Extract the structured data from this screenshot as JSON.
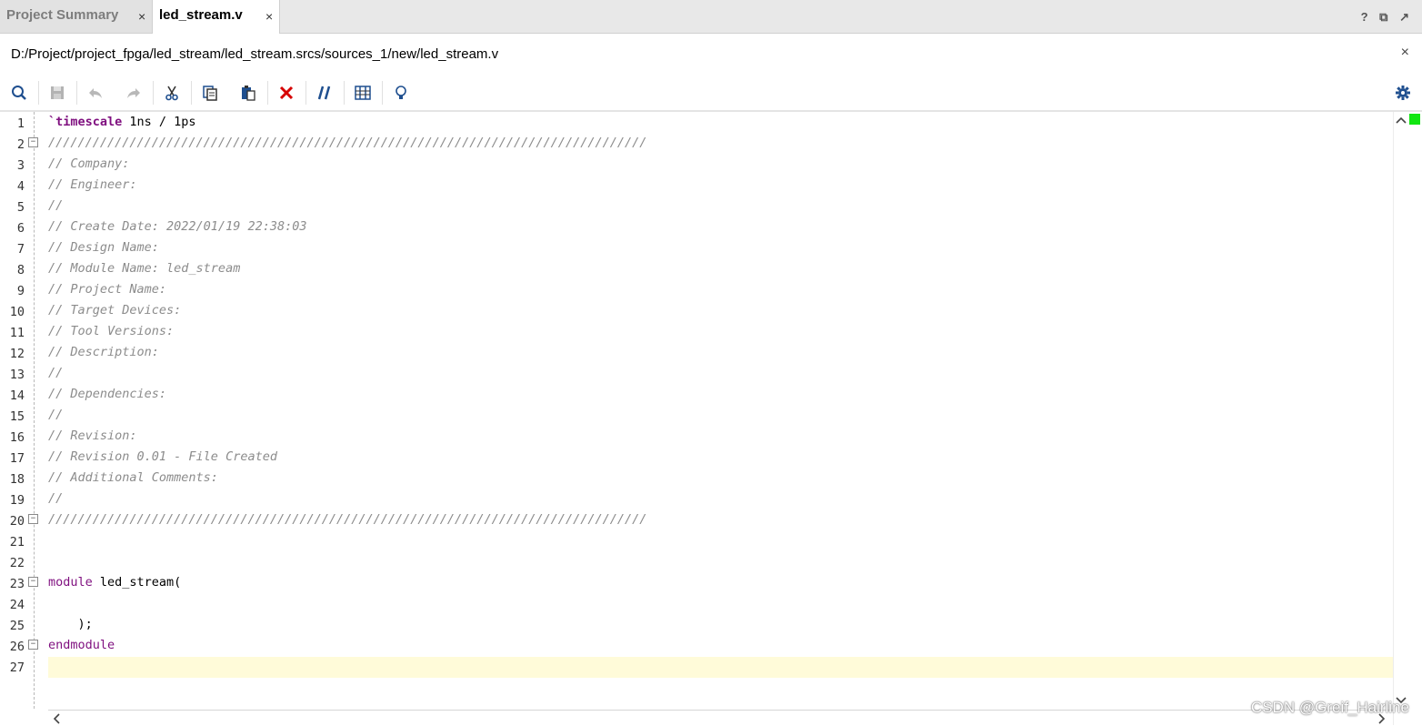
{
  "tabs": [
    {
      "label": "Project Summary",
      "close": "×"
    },
    {
      "label": "led_stream.v",
      "close": "×"
    }
  ],
  "window_icons": {
    "help": "?",
    "restore": "⧉",
    "float": "↗"
  },
  "path": {
    "text": "D:/Project/project_fpga/led_stream/led_stream.srcs/sources_1/new/led_stream.v",
    "close": "×"
  },
  "toolbar": {
    "icons": [
      "search-icon",
      "save-icon",
      "undo-icon",
      "redo-icon",
      "cut-icon",
      "copy-icon",
      "paste-icon",
      "delete-icon",
      "comment-icon",
      "columns-icon",
      "lightbulb-icon",
      "settings-icon"
    ]
  },
  "editor": {
    "highlight_line": 27,
    "lines": [
      {
        "n": "1",
        "parts": [
          {
            "t": "`timescale",
            "c": "kwb"
          },
          {
            "t": " 1ns / 1ps",
            "c": "plain"
          }
        ]
      },
      {
        "n": "2",
        "fold": true,
        "parts": [
          {
            "t": "/////////////////////////////////////////////////////////////////////////////////",
            "c": "comment"
          }
        ]
      },
      {
        "n": "3",
        "parts": [
          {
            "t": "// Company:",
            "c": "comment"
          }
        ]
      },
      {
        "n": "4",
        "parts": [
          {
            "t": "// Engineer:",
            "c": "comment"
          }
        ]
      },
      {
        "n": "5",
        "parts": [
          {
            "t": "//",
            "c": "comment"
          }
        ]
      },
      {
        "n": "6",
        "parts": [
          {
            "t": "// Create Date: 2022/01/19 22:38:03",
            "c": "comment"
          }
        ]
      },
      {
        "n": "7",
        "parts": [
          {
            "t": "// Design Name:",
            "c": "comment"
          }
        ]
      },
      {
        "n": "8",
        "parts": [
          {
            "t": "// Module Name: led_stream",
            "c": "comment"
          }
        ]
      },
      {
        "n": "9",
        "parts": [
          {
            "t": "// Project Name:",
            "c": "comment"
          }
        ]
      },
      {
        "n": "10",
        "parts": [
          {
            "t": "// Target Devices:",
            "c": "comment"
          }
        ]
      },
      {
        "n": "11",
        "parts": [
          {
            "t": "// Tool Versions:",
            "c": "comment"
          }
        ]
      },
      {
        "n": "12",
        "parts": [
          {
            "t": "// Description:",
            "c": "comment"
          }
        ]
      },
      {
        "n": "13",
        "parts": [
          {
            "t": "//",
            "c": "comment"
          }
        ]
      },
      {
        "n": "14",
        "parts": [
          {
            "t": "// Dependencies:",
            "c": "comment"
          }
        ]
      },
      {
        "n": "15",
        "parts": [
          {
            "t": "//",
            "c": "comment"
          }
        ]
      },
      {
        "n": "16",
        "parts": [
          {
            "t": "// Revision:",
            "c": "comment"
          }
        ]
      },
      {
        "n": "17",
        "parts": [
          {
            "t": "// Revision 0.01 - File Created",
            "c": "comment"
          }
        ]
      },
      {
        "n": "18",
        "parts": [
          {
            "t": "// Additional Comments:",
            "c": "comment"
          }
        ]
      },
      {
        "n": "19",
        "parts": [
          {
            "t": "//",
            "c": "comment"
          }
        ]
      },
      {
        "n": "20",
        "fold": true,
        "parts": [
          {
            "t": "/////////////////////////////////////////////////////////////////////////////////",
            "c": "comment"
          }
        ]
      },
      {
        "n": "21",
        "parts": []
      },
      {
        "n": "22",
        "parts": []
      },
      {
        "n": "23",
        "fold": true,
        "parts": [
          {
            "t": "module",
            "c": "kw"
          },
          {
            "t": " led_stream(",
            "c": "plain"
          }
        ]
      },
      {
        "n": "24",
        "parts": []
      },
      {
        "n": "25",
        "parts": [
          {
            "t": "    );",
            "c": "plain"
          }
        ]
      },
      {
        "n": "26",
        "fold": true,
        "parts": [
          {
            "t": "endmodule",
            "c": "kw"
          }
        ]
      },
      {
        "n": "27",
        "parts": []
      }
    ]
  },
  "watermark": "CSDN @Greif_Hairline"
}
